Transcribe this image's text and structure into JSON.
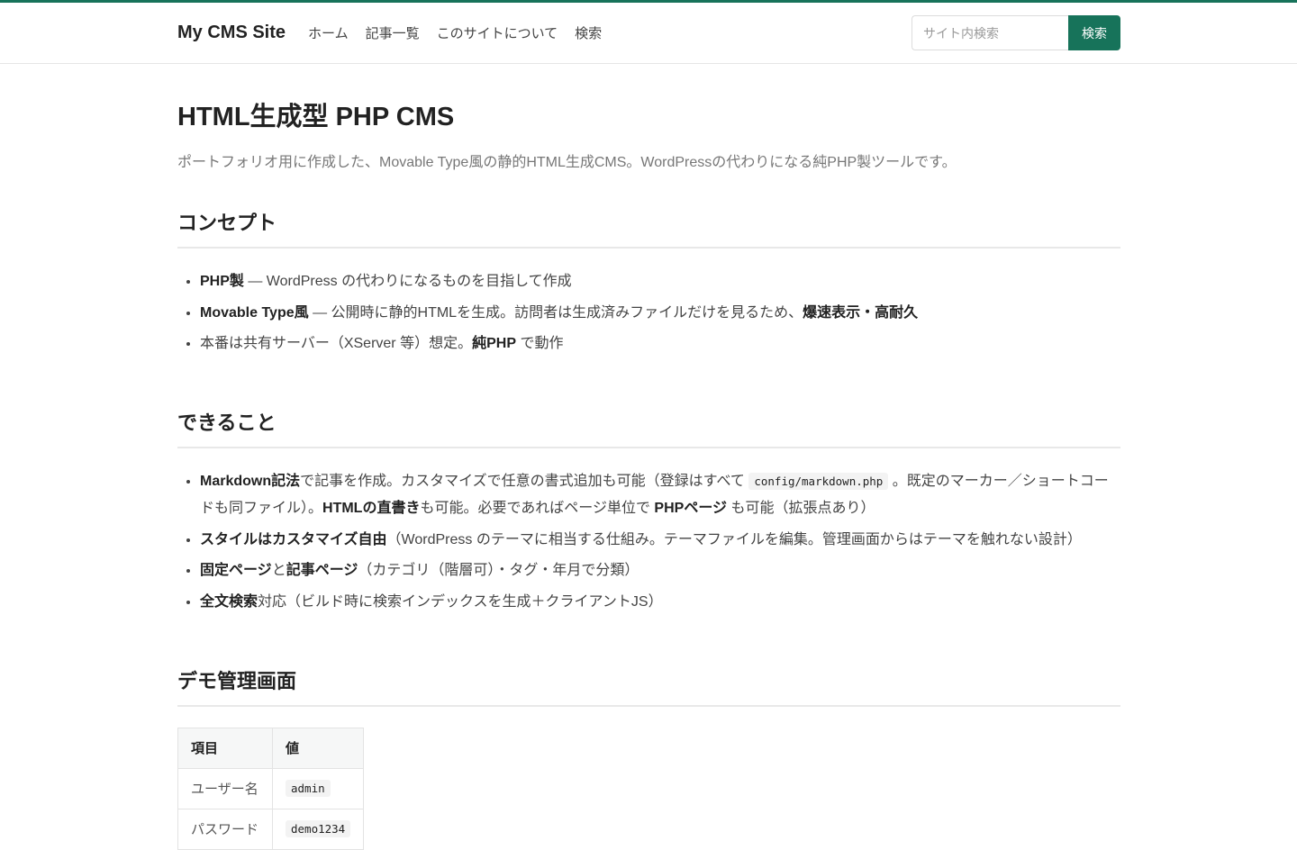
{
  "header": {
    "brand": "My CMS Site",
    "nav": [
      "ホーム",
      "記事一覧",
      "このサイトについて",
      "検索"
    ],
    "search_placeholder": "サイト内検索",
    "search_button": "検索"
  },
  "colors": {
    "accent": "#17735a"
  },
  "page": {
    "title": "HTML生成型 PHP CMS",
    "lead": "ポートフォリオ用に作成した、Movable Type風の静的HTML生成CMS。WordPressの代わりになる純PHP製ツールです。"
  },
  "concept": {
    "heading": "コンセプト",
    "item1": {
      "b1": "PHP製",
      "t1": " — WordPress の代わりになるものを目指して作成"
    },
    "item2": {
      "b1": "Movable Type風",
      "t1": " — 公開時に静的HTMLを生成。訪問者は生成済みファイルだけを見るため、",
      "b2": "爆速表示・高耐久"
    },
    "item3": {
      "t1": "本番は共有サーバー（XServer 等）想定。",
      "b1": "純PHP",
      "t2": " で動作"
    }
  },
  "features": {
    "heading": "できること",
    "item1": {
      "b1": "Markdown記法",
      "t1": "で記事を作成。カスタマイズで任意の書式追加も可能（登録はすべて ",
      "code": "config/markdown.php",
      "t2": " 。既定のマーカー／ショートコードも同ファイル）。",
      "b2": "HTMLの直書き",
      "t3": "も可能。必要であればページ単位で ",
      "b3": "PHPページ",
      "t4": " も可能（拡張点あり）"
    },
    "item2": {
      "b1": "スタイルはカスタマイズ自由",
      "t1": "（WordPress のテーマに相当する仕組み。テーマファイルを編集。管理画面からはテーマを触れない設計）"
    },
    "item3": {
      "b1": "固定ページ",
      "t1": "と",
      "b2": "記事ページ",
      "t2": "（カテゴリ（階層可）・タグ・年月で分類）"
    },
    "item4": {
      "b1": "全文検索",
      "t1": "対応（ビルド時に検索インデックスを生成＋クライアントJS）"
    }
  },
  "demo": {
    "heading": "デモ管理画面",
    "table": {
      "headers": [
        "項目",
        "値"
      ],
      "rows": [
        [
          "ユーザー名",
          "admin"
        ],
        [
          "パスワード",
          "demo1234"
        ]
      ]
    }
  }
}
